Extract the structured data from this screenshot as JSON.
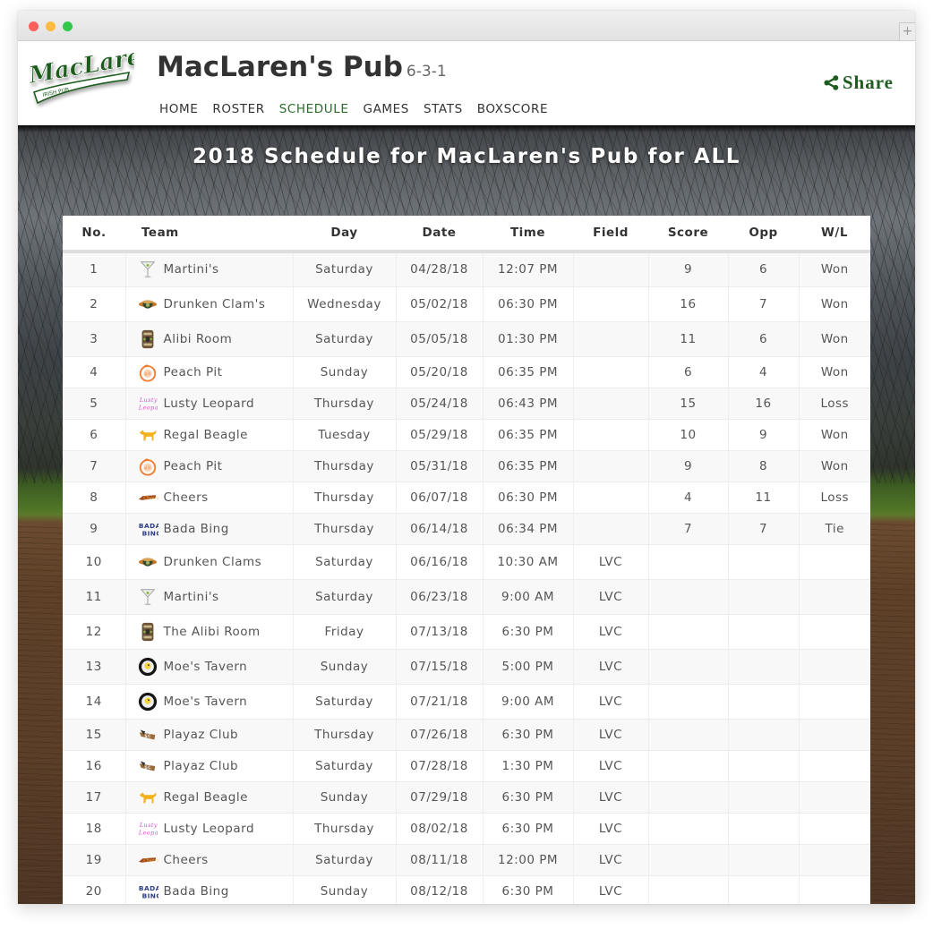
{
  "window": {
    "new_tab_label": "+"
  },
  "header": {
    "logo_alt": "MacLaren's Irish Pub",
    "title": "MacLaren's Pub",
    "record": "6-3-1",
    "nav": [
      {
        "label": "HOME",
        "active": false
      },
      {
        "label": "ROSTER",
        "active": false
      },
      {
        "label": "SCHEDULE",
        "active": true
      },
      {
        "label": "GAMES",
        "active": false
      },
      {
        "label": "STATS",
        "active": false
      },
      {
        "label": "BOXSCORE",
        "active": false
      }
    ],
    "share_label": "Share",
    "accent_color": "#1f5c1f"
  },
  "page": {
    "title": "2018 Schedule for MacLaren's Pub for ALL"
  },
  "schedule": {
    "columns": [
      "No.",
      "Team",
      "Day",
      "Date",
      "Time",
      "Field",
      "Score",
      "Opp",
      "W/L"
    ],
    "rows": [
      {
        "no": "1",
        "team": "Martini's",
        "icon": "martini-glass-icon",
        "day": "Saturday",
        "date": "04/28/18",
        "time": "12:07 PM",
        "field": "",
        "score": "9",
        "opp": "6",
        "wl": "Won"
      },
      {
        "no": "2",
        "team": "Drunken Clam's",
        "icon": "drunken-clam-icon",
        "day": "Wednesday",
        "date": "05/02/18",
        "time": "06:30 PM",
        "field": "",
        "score": "16",
        "opp": "7",
        "wl": "Won"
      },
      {
        "no": "3",
        "team": "Alibi Room",
        "icon": "alibi-room-icon",
        "day": "Saturday",
        "date": "05/05/18",
        "time": "01:30 PM",
        "field": "",
        "score": "11",
        "opp": "6",
        "wl": "Won"
      },
      {
        "no": "4",
        "team": "Peach Pit",
        "icon": "peach-pit-icon",
        "day": "Sunday",
        "date": "05/20/18",
        "time": "06:35 PM",
        "field": "",
        "score": "6",
        "opp": "4",
        "wl": "Won"
      },
      {
        "no": "5",
        "team": "Lusty Leopard",
        "icon": "lusty-leopard-icon",
        "day": "Thursday",
        "date": "05/24/18",
        "time": "06:43 PM",
        "field": "",
        "score": "15",
        "opp": "16",
        "wl": "Loss"
      },
      {
        "no": "6",
        "team": "Regal Beagle",
        "icon": "regal-beagle-icon",
        "day": "Tuesday",
        "date": "05/29/18",
        "time": "06:35 PM",
        "field": "",
        "score": "10",
        "opp": "9",
        "wl": "Won"
      },
      {
        "no": "7",
        "team": "Peach Pit",
        "icon": "peach-pit-icon",
        "day": "Thursday",
        "date": "05/31/18",
        "time": "06:35 PM",
        "field": "",
        "score": "9",
        "opp": "8",
        "wl": "Won"
      },
      {
        "no": "8",
        "team": "Cheers",
        "icon": "cheers-icon",
        "day": "Thursday",
        "date": "06/07/18",
        "time": "06:30 PM",
        "field": "",
        "score": "4",
        "opp": "11",
        "wl": "Loss"
      },
      {
        "no": "9",
        "team": "Bada Bing",
        "icon": "bada-bing-icon",
        "day": "Thursday",
        "date": "06/14/18",
        "time": "06:34 PM",
        "field": "",
        "score": "7",
        "opp": "7",
        "wl": "Tie"
      },
      {
        "no": "10",
        "team": "Drunken Clams",
        "icon": "drunken-clam-icon",
        "day": "Saturday",
        "date": "06/16/18",
        "time": "10:30 AM",
        "field": "LVC",
        "score": "",
        "opp": "",
        "wl": ""
      },
      {
        "no": "11",
        "team": "Martini's",
        "icon": "martini-glass-icon",
        "day": "Saturday",
        "date": "06/23/18",
        "time": "9:00 AM",
        "field": "LVC",
        "score": "",
        "opp": "",
        "wl": ""
      },
      {
        "no": "12",
        "team": "The Alibi Room",
        "icon": "alibi-room-icon",
        "day": "Friday",
        "date": "07/13/18",
        "time": "6:30 PM",
        "field": "LVC",
        "score": "",
        "opp": "",
        "wl": ""
      },
      {
        "no": "13",
        "team": "Moe's Tavern",
        "icon": "moes-tavern-icon",
        "day": "Sunday",
        "date": "07/15/18",
        "time": "5:00 PM",
        "field": "LVC",
        "score": "",
        "opp": "",
        "wl": ""
      },
      {
        "no": "14",
        "team": "Moe's Tavern",
        "icon": "moes-tavern-icon",
        "day": "Saturday",
        "date": "07/21/18",
        "time": "9:00 AM",
        "field": "LVC",
        "score": "",
        "opp": "",
        "wl": ""
      },
      {
        "no": "15",
        "team": "Playaz Club",
        "icon": "playaz-club-icon",
        "day": "Thursday",
        "date": "07/26/18",
        "time": "6:30 PM",
        "field": "LVC",
        "score": "",
        "opp": "",
        "wl": ""
      },
      {
        "no": "16",
        "team": "Playaz Club",
        "icon": "playaz-club-icon",
        "day": "Saturday",
        "date": "07/28/18",
        "time": "1:30 PM",
        "field": "LVC",
        "score": "",
        "opp": "",
        "wl": ""
      },
      {
        "no": "17",
        "team": "Regal Beagle",
        "icon": "regal-beagle-icon",
        "day": "Sunday",
        "date": "07/29/18",
        "time": "6:30 PM",
        "field": "LVC",
        "score": "",
        "opp": "",
        "wl": ""
      },
      {
        "no": "18",
        "team": "Lusty Leopard",
        "icon": "lusty-leopard-icon",
        "day": "Thursday",
        "date": "08/02/18",
        "time": "6:30 PM",
        "field": "LVC",
        "score": "",
        "opp": "",
        "wl": ""
      },
      {
        "no": "19",
        "team": "Cheers",
        "icon": "cheers-icon",
        "day": "Saturday",
        "date": "08/11/18",
        "time": "12:00 PM",
        "field": "LVC",
        "score": "",
        "opp": "",
        "wl": ""
      },
      {
        "no": "20",
        "team": "Bada Bing",
        "icon": "bada-bing-icon",
        "day": "Sunday",
        "date": "08/12/18",
        "time": "6:30 PM",
        "field": "LVC",
        "score": "",
        "opp": "",
        "wl": ""
      }
    ]
  }
}
